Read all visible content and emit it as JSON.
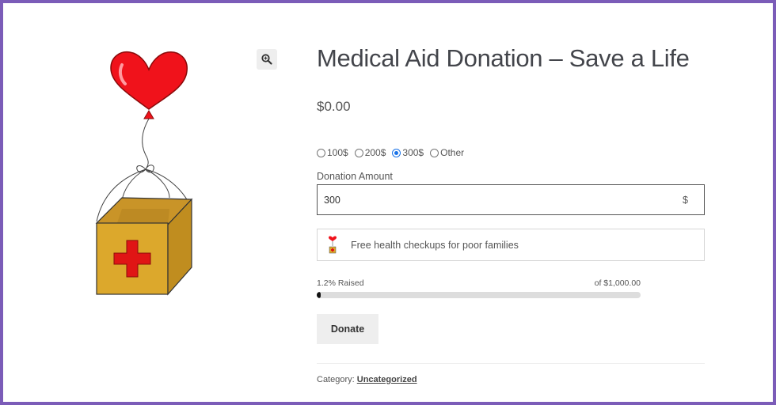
{
  "product": {
    "title": "Medical Aid Donation – Save a Life",
    "price": "$0.00",
    "image_icon": "heart-balloon-medical-box"
  },
  "donation": {
    "options": [
      {
        "label": "100$",
        "selected": false
      },
      {
        "label": "200$",
        "selected": false
      },
      {
        "label": "300$",
        "selected": true
      },
      {
        "label": "Other",
        "selected": false
      }
    ],
    "amount_label": "Donation Amount",
    "amount_value": "300",
    "currency": "$"
  },
  "campaign": {
    "text": "Free health checkups for poor families",
    "raised_text": "1.2% Raised",
    "goal_text": "of $1,000.00",
    "progress_fraction": 0.012
  },
  "actions": {
    "donate_label": "Donate",
    "zoom_icon": "zoom-in-icon"
  },
  "meta": {
    "category_prefix": "Category: ",
    "category": "Uncategorized"
  },
  "colors": {
    "frame": "#7b5cb8",
    "heart": "#f0121b",
    "box": "#d9a52b",
    "cross": "#e01515",
    "radio_selected": "#1a73e8"
  }
}
